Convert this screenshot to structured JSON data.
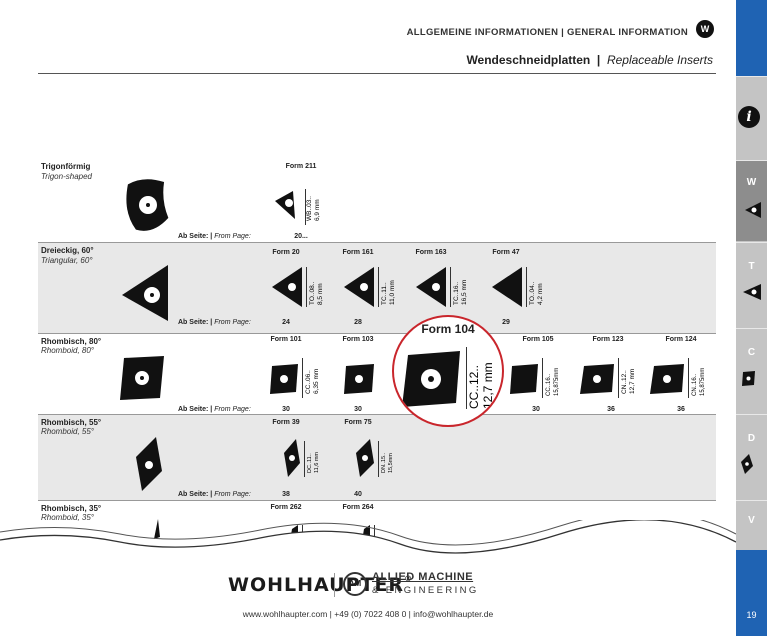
{
  "header": {
    "section": "ALLGEMEINE INFORMATIONEN  |  GENERAL INFORMATION",
    "title_de": "Wendeschneidplatten",
    "title_sep": "|",
    "title_en": "Replaceable Inserts",
    "logo_letter": "W"
  },
  "table": {
    "from_page_label_de": "Ab Seite: |",
    "from_page_label_en": "From Page:",
    "rows": [
      {
        "name": "Trigonförmig",
        "sub": "Trigon-shaped",
        "forms": [
          {
            "title": "Form 211",
            "code": "WB..03..",
            "size": "6,9 mm",
            "page": "20..."
          }
        ]
      },
      {
        "name": "Dreieckig, 60°",
        "sub": "Triangular, 60°",
        "forms": [
          {
            "title": "Form 20",
            "code": "TO..08..",
            "size": "8,5 mm",
            "page": "24"
          },
          {
            "title": "Form 161",
            "code": "TC..11..",
            "size": "11,0 mm",
            "page": "28"
          },
          {
            "title": "Form 163",
            "code": "TC..16..",
            "size": "16,5 mm",
            "page": ""
          },
          {
            "title": "Form 47",
            "code": "TO..04..",
            "size": "4,2 mm",
            "page": "29"
          }
        ]
      },
      {
        "name": "Rhombisch, 80°",
        "sub": "Rhomboid, 80°",
        "forms": [
          {
            "title": "Form 101",
            "code": "CC..06..",
            "size": "6,35 mm",
            "page": "30"
          },
          {
            "title": "Form 103",
            "code": "",
            "size": "",
            "page": "30"
          },
          {
            "title": "Form 105",
            "code": "CC..16..",
            "size": "15,875mm",
            "page": "30"
          },
          {
            "title": "Form 123",
            "code": "CN..12..",
            "size": "12,7 mm",
            "page": "36"
          },
          {
            "title": "Form 124",
            "code": "CN..16..",
            "size": "15,875mm",
            "page": "36"
          }
        ]
      },
      {
        "name": "Rhombisch, 55°",
        "sub": "Rhomboid, 55°",
        "forms": [
          {
            "title": "Form 39",
            "code": "DC..11..",
            "size": "11,6 mm",
            "page": "38"
          },
          {
            "title": "Form 75",
            "code": "DN..15..",
            "size": "15,5mm",
            "page": "40"
          }
        ]
      },
      {
        "name": "Rhombisch, 35°",
        "sub": "Rhomboid, 35°",
        "forms": [
          {
            "title": "Form 262",
            "code": "",
            "size": "",
            "page": ""
          },
          {
            "title": "Form 264",
            "code": "",
            "size": "",
            "page": ""
          }
        ]
      }
    ]
  },
  "zoom": {
    "title": "Form 104",
    "code": "CC..12..",
    "size": "12,7 mm"
  },
  "footer": {
    "brand": "WOHLHAUPTER",
    "reg": "®",
    "partner_line1": "ALLIED MACHINE",
    "partner_line2": "& ENGINEERING",
    "contact": "www.wohlhaupter.com   |  +49 (0) 7022 408 0  |  info@wohlhaupter.de"
  },
  "sidebar": {
    "tabs": [
      {
        "letter": "W",
        "active": true
      },
      {
        "letter": "T",
        "active": false
      },
      {
        "letter": "C",
        "active": false
      },
      {
        "letter": "D",
        "active": false
      },
      {
        "letter": "V",
        "active": false
      }
    ],
    "info_icon": "info-icon",
    "page_number": "19",
    "accent": "#1f63b3",
    "highlight": "#c9262c"
  }
}
